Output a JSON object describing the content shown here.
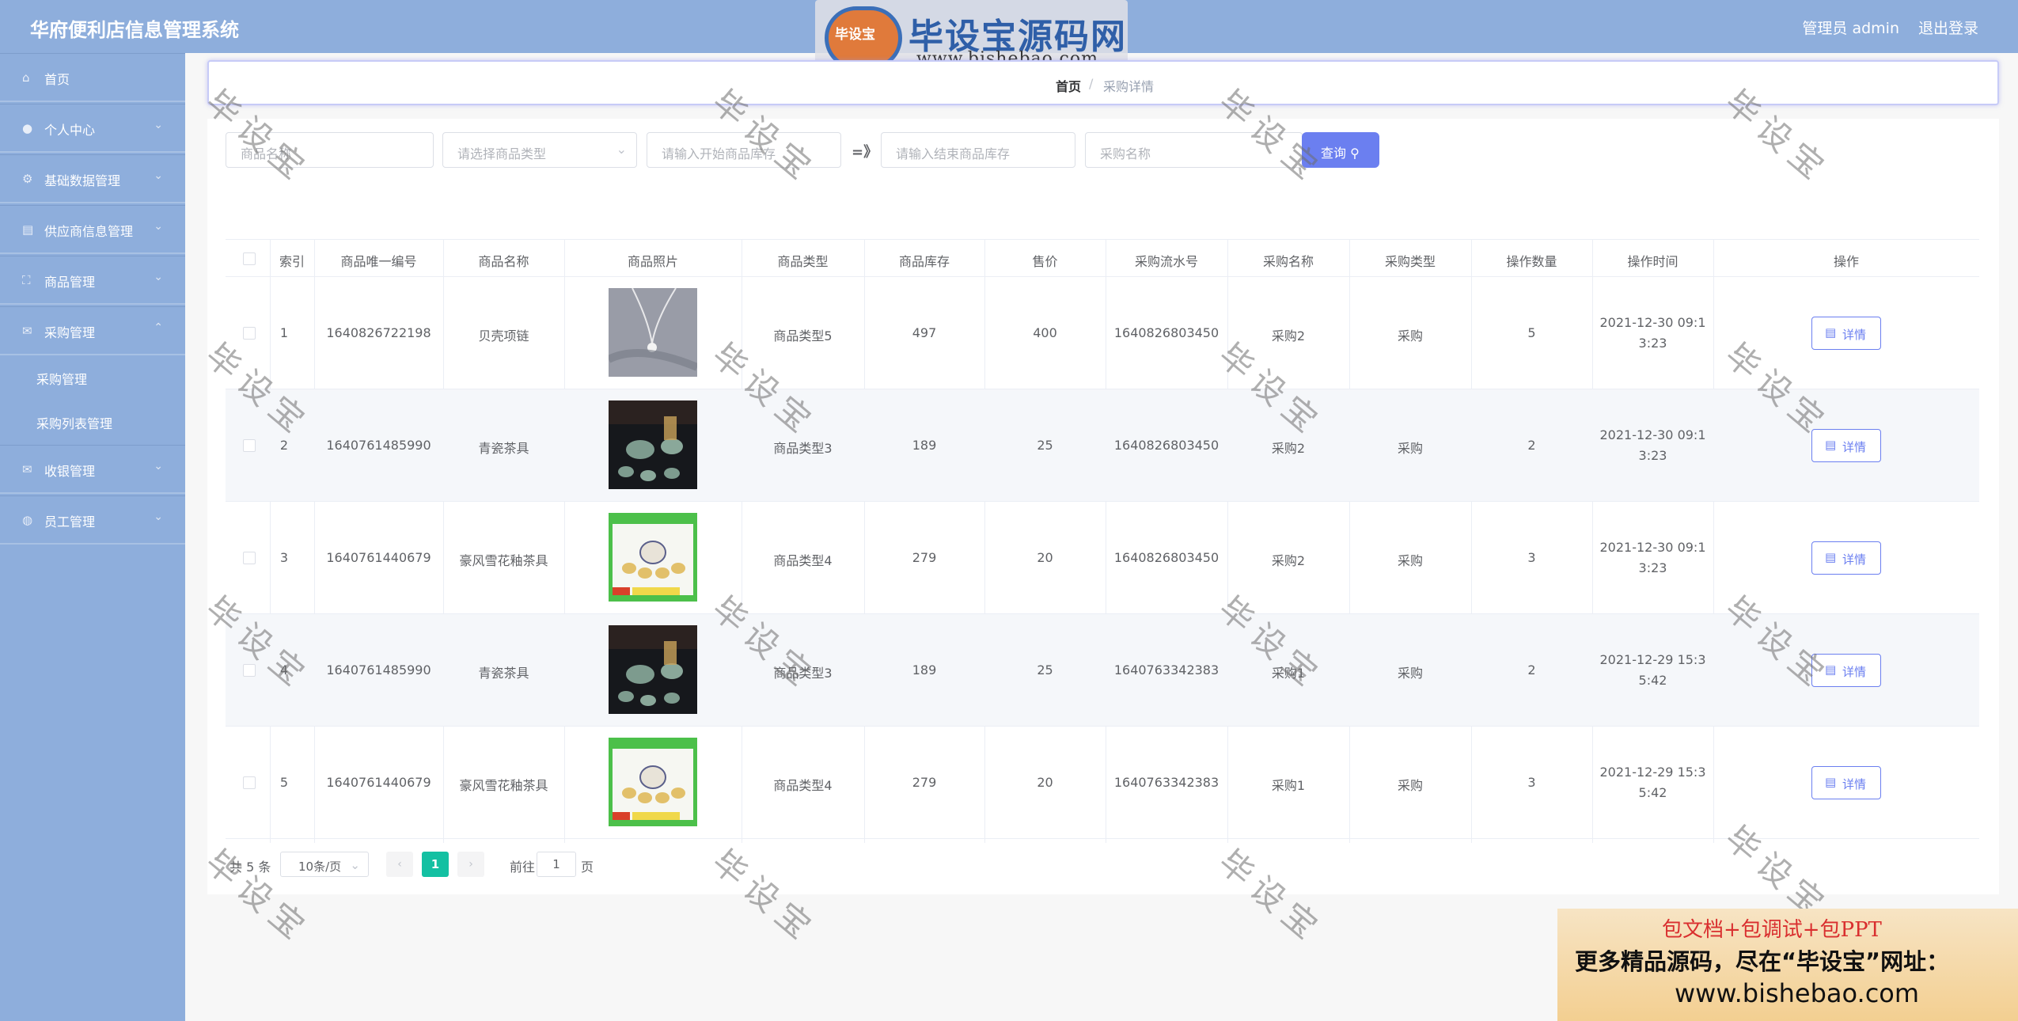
{
  "header": {
    "title": "华府便利店信息管理系统",
    "admin": "管理员 admin",
    "logout": "退出登录"
  },
  "watermark_logo": {
    "badge": "毕设宝",
    "name": "毕设宝源码网",
    "url": "www.bishebao.com"
  },
  "sidebar": {
    "items": [
      {
        "label": "首页",
        "icon": "home-icon"
      },
      {
        "label": "个人中心",
        "icon": "user-icon"
      },
      {
        "label": "基础数据管理",
        "icon": "settings-icon"
      },
      {
        "label": "供应商信息管理",
        "icon": "clipboard-icon"
      },
      {
        "label": "商品管理",
        "icon": "expand-icon"
      },
      {
        "label": "采购管理",
        "icon": "mail-icon"
      },
      {
        "label": "收银管理",
        "icon": "mail-icon"
      },
      {
        "label": "员工管理",
        "icon": "globe-icon"
      }
    ],
    "subitems": [
      "采购管理",
      "采购列表管理"
    ]
  },
  "breadcrumb": {
    "home": "首页",
    "sep": "/",
    "current": "采购详情"
  },
  "filters": {
    "name_placeholder": "商品名称",
    "type_placeholder": "请选择商品类型",
    "start_stock_placeholder": "请输入开始商品库存",
    "range_sep": "=》",
    "end_stock_placeholder": "请输入结束商品库存",
    "purchase_name_placeholder": "采购名称",
    "query_label": "查询 ⚲"
  },
  "table": {
    "headers": [
      "索引",
      "商品唯一编号",
      "商品名称",
      "商品照片",
      "商品类型",
      "商品库存",
      "售价",
      "采购流水号",
      "采购名称",
      "采购类型",
      "操作数量",
      "操作时间",
      "操作"
    ],
    "rows": [
      {
        "index": "1",
        "code": "1640826722198",
        "name": "贝壳项链",
        "photo": "necklace",
        "type": "商品类型5",
        "stock": "497",
        "price": "400",
        "serial": "1640826803450",
        "pname": "采购2",
        "ptype": "采购",
        "qty": "5",
        "time1": "2021-12-30 09:1",
        "time2": "3:23"
      },
      {
        "index": "2",
        "code": "1640761485990",
        "name": "青瓷茶具",
        "photo": "tea-set-dark",
        "type": "商品类型3",
        "stock": "189",
        "price": "25",
        "serial": "1640826803450",
        "pname": "采购2",
        "ptype": "采购",
        "qty": "2",
        "time1": "2021-12-30 09:1",
        "time2": "3:23"
      },
      {
        "index": "3",
        "code": "1640761440679",
        "name": "豪风雪花釉茶具",
        "photo": "tea-set-green",
        "type": "商品类型4",
        "stock": "279",
        "price": "20",
        "serial": "1640826803450",
        "pname": "采购2",
        "ptype": "采购",
        "qty": "3",
        "time1": "2021-12-30 09:1",
        "time2": "3:23"
      },
      {
        "index": "4",
        "code": "1640761485990",
        "name": "青瓷茶具",
        "photo": "tea-set-dark",
        "type": "商品类型3",
        "stock": "189",
        "price": "25",
        "serial": "1640763342383",
        "pname": "采购1",
        "ptype": "采购",
        "qty": "2",
        "time1": "2021-12-29 15:3",
        "time2": "5:42"
      },
      {
        "index": "5",
        "code": "1640761440679",
        "name": "豪风雪花釉茶具",
        "photo": "tea-set-green",
        "type": "商品类型4",
        "stock": "279",
        "price": "20",
        "serial": "1640763342383",
        "pname": "采购1",
        "ptype": "采购",
        "qty": "3",
        "time1": "2021-12-29 15:3",
        "time2": "5:42"
      }
    ],
    "detail_label": "详情"
  },
  "pagination": {
    "total": "共 5 条",
    "page_size": "10条/页",
    "prev": "‹",
    "current": "1",
    "next": "›",
    "goto": "前往",
    "goto_value": "1",
    "page_unit": "页"
  },
  "watermark_text": "毕设宝",
  "ad": {
    "line1": "包文档+包调试+包PPT",
    "line2": "更多精品源码，尽在“毕设宝”网址：",
    "line3": "www.bishebao.com"
  },
  "colors": {
    "sidebar": "#8eaedc",
    "accent": "#6b7ff0",
    "pager_active": "#13c0a2"
  }
}
